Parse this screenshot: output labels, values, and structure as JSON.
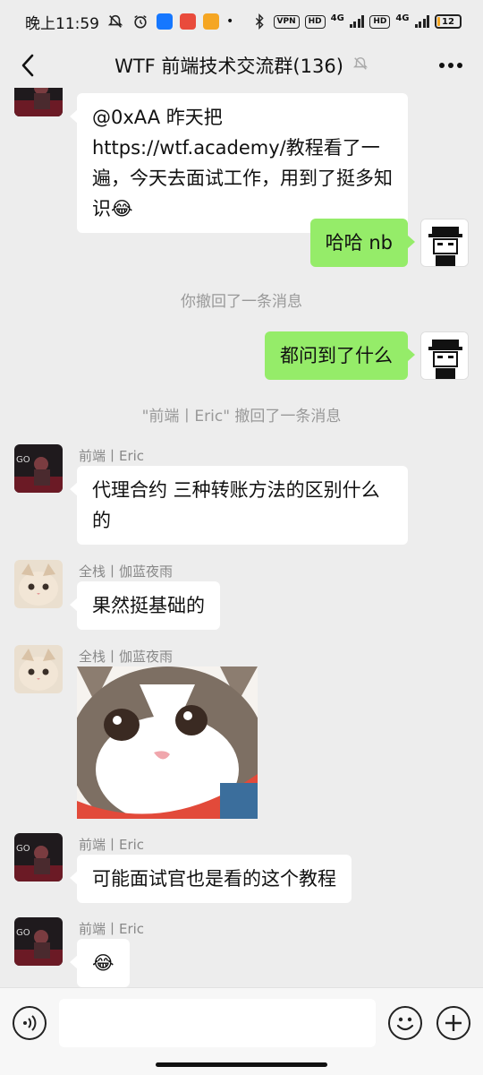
{
  "status_bar": {
    "time": "晚上11:59",
    "vpn": "VPN",
    "hd1": "HD",
    "net1": "4G",
    "hd2": "HD",
    "net2": "4G",
    "battery": "12",
    "battery_level": 0.12,
    "icons": [
      "mute-bell-icon",
      "alarm-icon",
      "alipay-icon",
      "app-icon",
      "app-icon",
      "dot-icon",
      "bluetooth-icon"
    ]
  },
  "nav": {
    "title": "WTF 前端技术交流群(136)",
    "back_icon": "chevron-left-icon",
    "mute_icon": "bell-off-icon",
    "more_icon": "more-dots-icon"
  },
  "messages": {
    "m1": {
      "text": "@0xAA 昨天把 https://wtf.academy/教程看了一遍，今天去面试工作，用到了挺多知识😂"
    },
    "m2": {
      "text": "哈哈 nb"
    },
    "sys1": "你撤回了一条消息",
    "m3": {
      "text": "都问到了什么"
    },
    "sys2": "\"前端丨Eric\" 撤回了一条消息",
    "m4": {
      "sender": "前端丨Eric",
      "text": "代理合约  三种转账方法的区别什么的"
    },
    "m5": {
      "sender": "全栈丨伽蓝夜雨",
      "text": "果然挺基础的"
    },
    "m6": {
      "sender": "全栈丨伽蓝夜雨",
      "sticker": "cat-sticker"
    },
    "m7": {
      "sender": "前端丨Eric",
      "text": "可能面试官也是看的这个教程"
    },
    "m8": {
      "sender": "前端丨Eric",
      "text": "😂"
    }
  },
  "input_bar": {
    "voice_icon": "voice-icon",
    "emoji_icon": "emoji-icon",
    "plus_icon": "plus-icon"
  },
  "colors": {
    "background": "#ededed",
    "bubble_out": "#95ec69",
    "bubble_in": "#ffffff",
    "system_text": "#999999"
  }
}
